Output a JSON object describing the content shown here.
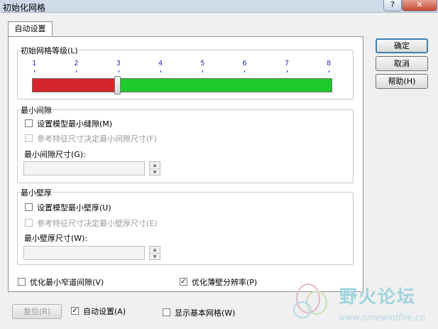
{
  "window": {
    "title": "初始化网格",
    "help_label": "?",
    "close_label": "✕"
  },
  "tab": {
    "label": "自动设置"
  },
  "mesh_level": {
    "legend": "初始网格等级(L)",
    "ticks": [
      "1",
      "2",
      "3",
      "4",
      "5",
      "6",
      "7",
      "8"
    ],
    "value": 3,
    "min": 1,
    "max": 8,
    "low_color": "#d4262b",
    "high_color": "#1fca2c"
  },
  "min_gap": {
    "legend": "最小间隙",
    "set_model_label": "设置模型最小缝隙(M)",
    "set_model_checked": false,
    "ref_feature_label": "参考特征尺寸决定最小间隙尺寸(F)",
    "ref_feature_checked": false,
    "size_label": "最小间隙尺寸(G):",
    "size_value": ""
  },
  "min_wall": {
    "legend": "最小壁厚",
    "set_model_label": "设置模型最小壁厚(U)",
    "set_model_checked": false,
    "ref_feature_label": "参考特征尺寸决定最小壁厚尺寸(E)",
    "ref_feature_checked": false,
    "size_label": "最小壁厚尺寸(W):",
    "size_value": ""
  },
  "options": {
    "narrow_gap_label": "优化最小窄道间隙(V)",
    "narrow_gap_checked": false,
    "thin_wall_label": "优化薄壁分辨率(P)",
    "thin_wall_checked": true
  },
  "buttons": {
    "ok": "确定",
    "cancel": "取消",
    "help": "帮助(H)"
  },
  "footer": {
    "reset_label": "复位(R)",
    "auto_label": "自动设置(A)",
    "auto_checked": true,
    "show_base_mesh_label": "显示基本网格(W)",
    "show_base_mesh_checked": false
  },
  "watermark": {
    "text": "野火论坛",
    "url": "www.proewildfire.cn"
  },
  "check_glyph": "✓"
}
